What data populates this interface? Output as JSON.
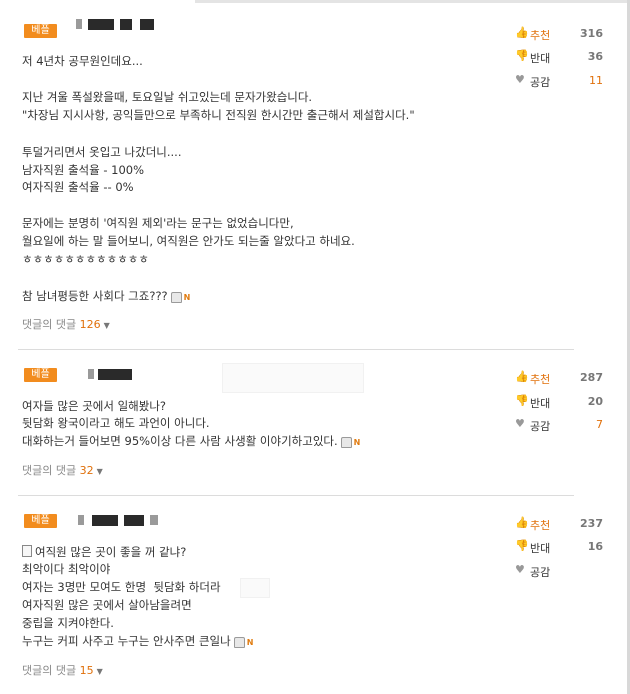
{
  "badges": {
    "best": "베플"
  },
  "labels": {
    "recommend": "추천",
    "oppose": "반대",
    "sympathy": "공감",
    "reply_prefix": "댓글의 댓글"
  },
  "icons": {
    "recommend": "thumbs-up-icon",
    "oppose": "thumbs-down-icon",
    "sympathy": "heart-icon",
    "attachment": "mobile-icon",
    "new": "new-icon",
    "memo": "memo-icon",
    "caret": "caret-down-icon"
  },
  "colors": {
    "badge": "#f28c1e",
    "accent": "#e0700b"
  },
  "comments": [
    {
      "lines": [
        "저 4년차 공무원인데요...",
        "",
        "지난 겨울 폭설왔을때, 토요일날 쉬고있는데 문자가왔습니다.",
        "\"차장님 지시사항, 공익들만으로 부족하니 전직원 한시간만 출근해서 제설합시다.\"",
        "",
        "투덜거리면서 옷입고 나갔더니....",
        "남자직원 출석율 - 100%",
        "여자직원 출석율 -- 0%",
        "",
        "문자에는 분명히 '여직원 제외'라는 문구는 없었습니다만,",
        "월요일에 하는 말 들어보니, 여직원은 안가도 되는줄 알았다고 하네요.",
        "ㅎㅎㅎㅎㅎㅎㅎㅎㅎㅎㅎㅎ",
        "",
        "참 남녀평등한 사회다 그죠???"
      ],
      "reply_count": "126",
      "recommend": "316",
      "oppose": "36",
      "sympathy": "11"
    },
    {
      "lines": [
        "여자들 많은 곳에서 일해봤나?",
        "뒷담화 왕국이라고 해도 과언이 아니다.",
        "대화하는거 들어보면 95%이상 다른 사람 사생활 이야기하고있다."
      ],
      "reply_count": "32",
      "recommend": "287",
      "oppose": "20",
      "sympathy": "7"
    },
    {
      "lines": [
        "여직원 많은 곳이 좋을 꺼 같냐?",
        "최악이다 최악이야",
        "여자는 3명만 모여도 한명  뒷담화 하더라",
        "여자직원 많은 곳에서 살아남을려면",
        "중립을 지켜야한다.",
        "누구는 커피 사주고 누구는 안사주면 큰일나"
      ],
      "reply_count": "15",
      "recommend": "237",
      "oppose": "16",
      "sympathy": ""
    }
  ]
}
